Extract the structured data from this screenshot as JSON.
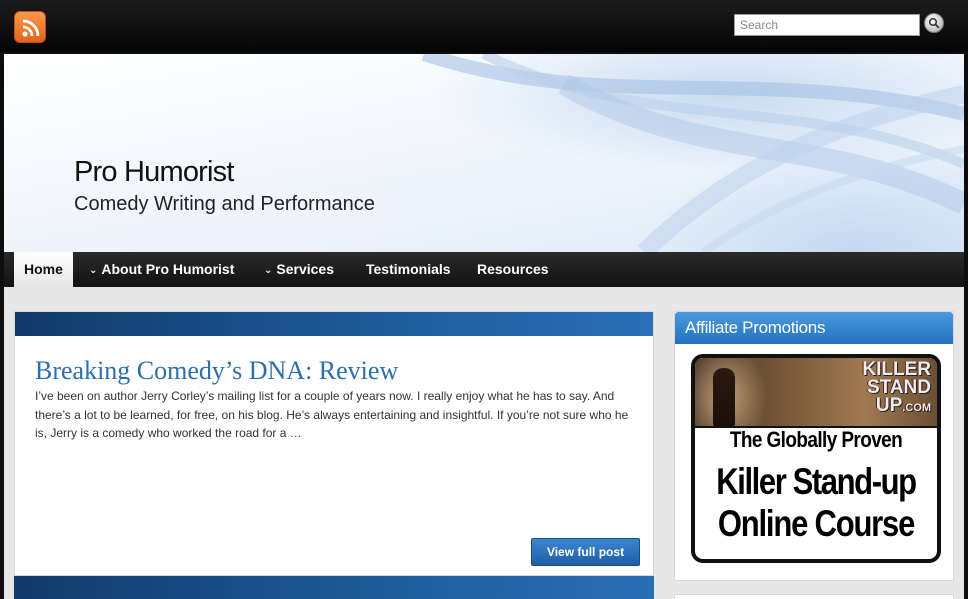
{
  "topbar": {
    "search_placeholder": "Search"
  },
  "header": {
    "title": "Pro Humorist",
    "tagline": "Comedy Writing and Performance"
  },
  "nav": {
    "items": [
      {
        "label": "Home",
        "active": true,
        "has_dropdown": false
      },
      {
        "label": "About Pro Humorist",
        "active": false,
        "has_dropdown": true
      },
      {
        "label": "Services",
        "active": false,
        "has_dropdown": true
      },
      {
        "label": "Testimonials",
        "active": false,
        "has_dropdown": false
      },
      {
        "label": "Resources",
        "active": false,
        "has_dropdown": false
      }
    ]
  },
  "post": {
    "title": "Breaking Comedy’s DNA: Review",
    "excerpt": "I’ve been on author Jerry Corley’s mailing list for a couple of years now. I really enjoy what he has to say. And there’s a lot to be learned, for free, on his blog. He’s always entertaining and insightful. If you’re not sure who he is, Jerry is a comedy who worked the road for a …",
    "button_label": "View full post"
  },
  "sidebar": {
    "widget_title": "Affiliate Promotions",
    "ad": {
      "logo_line1": "KILLER",
      "logo_line2": "STAND",
      "logo_line3": "UP",
      "logo_suffix": ".COM",
      "line1": "The Globally Proven",
      "line2": "Killer Stand-up",
      "line3": "Online Course"
    }
  },
  "colors": {
    "accent_blue": "#2b6fae",
    "nav_bg": "#1a1a1a",
    "widget_header": "#3a86d2"
  }
}
